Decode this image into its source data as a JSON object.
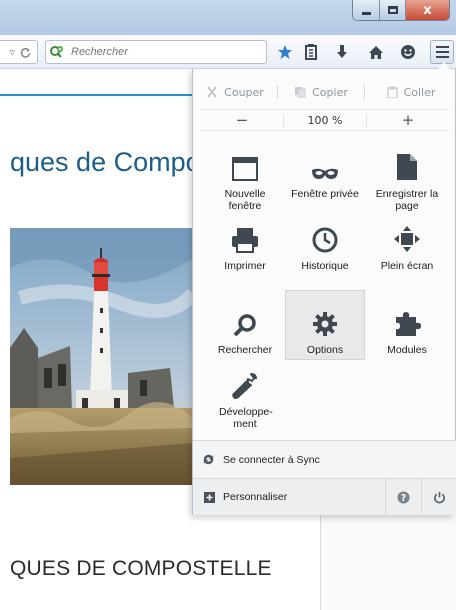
{
  "window": {
    "close_glyph": "x"
  },
  "toolbar": {
    "search_placeholder": "Rechercher",
    "icons": [
      "dropdown-icon",
      "reload-icon",
      "bookmark-star-icon",
      "reading-list-icon",
      "download-icon",
      "home-icon",
      "hello-icon",
      "hamburger-menu-icon"
    ]
  },
  "page": {
    "heading": "ques de Compo",
    "subheading": "QUES DE COMPOSTELLE"
  },
  "menu": {
    "edit": {
      "cut": "Couper",
      "copy": "Copier",
      "paste": "Coller"
    },
    "zoom": {
      "minus": "−",
      "level": "100 %",
      "plus": "+"
    },
    "tiles": [
      {
        "label": "Nouvelle fenêtre",
        "icon": "new-window-icon"
      },
      {
        "label": "Fenêtre privée",
        "icon": "private-window-mask-icon"
      },
      {
        "label": "Enregistrer la page",
        "icon": "save-page-icon"
      },
      {
        "label": "Imprimer",
        "icon": "printer-icon"
      },
      {
        "label": "Historique",
        "icon": "history-clock-icon"
      },
      {
        "label": "Plein écran",
        "icon": "fullscreen-icon"
      },
      {
        "label": "Rechercher",
        "icon": "search-icon"
      },
      {
        "label": "Options",
        "icon": "gear-icon",
        "active": true
      },
      {
        "label": "Modules",
        "icon": "puzzle-icon"
      },
      {
        "label": "Développe-ment",
        "icon": "wrench-icon"
      }
    ],
    "sync": "Se connecter à Sync",
    "customize": "Personnaliser"
  },
  "colors": {
    "accent": "#2b8dc9",
    "heading": "#1c5f8b",
    "star": "#2a7fd4"
  }
}
